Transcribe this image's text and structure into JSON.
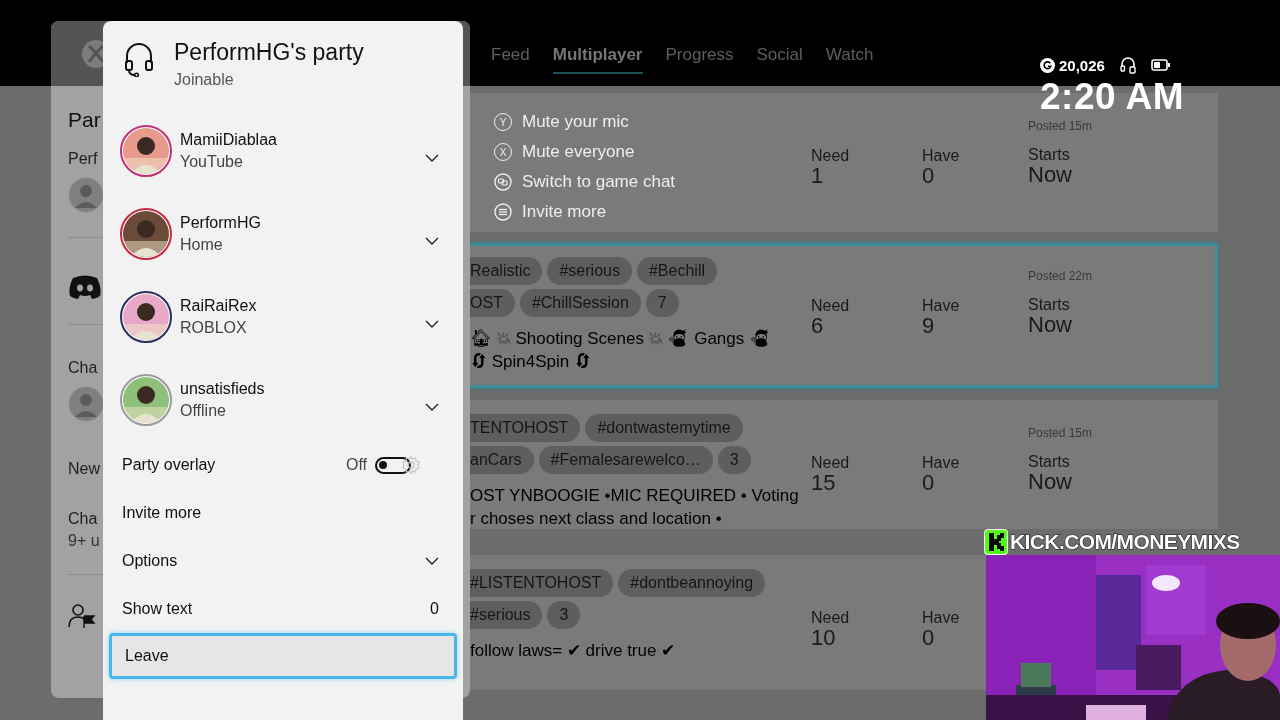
{
  "top_bar": {
    "tabs": [
      {
        "label": "Feed",
        "selected": false
      },
      {
        "label": "Multiplayer",
        "selected": true
      },
      {
        "label": "Progress",
        "selected": false
      },
      {
        "label": "Social",
        "selected": false
      },
      {
        "label": "Watch",
        "selected": false
      }
    ],
    "gamerscore": "20,026",
    "time": "2:20 AM"
  },
  "guide": {
    "items": [
      {
        "kind": "heading",
        "text": "Par"
      },
      {
        "kind": "label",
        "text": "Perf"
      },
      {
        "kind": "avatar"
      },
      {
        "kind": "divider"
      },
      {
        "kind": "discord"
      },
      {
        "kind": "divider"
      },
      {
        "kind": "label",
        "text": "Cha"
      },
      {
        "kind": "avatar"
      },
      {
        "kind": "label",
        "text": "New"
      },
      {
        "kind": "label",
        "text": "Cha"
      },
      {
        "kind": "sub",
        "text": "9+ u"
      },
      {
        "kind": "divider"
      },
      {
        "kind": "person-flag"
      }
    ]
  },
  "posts": [
    {
      "focused": false,
      "hints": [
        {
          "kind": "letter",
          "glyph": "Y",
          "text": "Mute your mic"
        },
        {
          "kind": "letter",
          "glyph": "X",
          "text": "Mute everyone"
        },
        {
          "kind": "view",
          "text": "Switch to game chat"
        },
        {
          "kind": "menu",
          "text": "Invite more"
        }
      ],
      "posted": "Posted 15m",
      "stats": [
        {
          "label": "Need",
          "value": "1"
        },
        {
          "label": "Have",
          "value": "0"
        },
        {
          "label": "Starts",
          "value": "Now"
        }
      ]
    },
    {
      "focused": true,
      "tag_rows": [
        [
          "Realistic",
          "#serious",
          "#Bechill"
        ],
        [
          "OST",
          "#ChillSession",
          "7"
        ]
      ],
      "description": [
        "🏠 💥 Shooting Scenes 💥 🥷 Gangs 🥷",
        "🔄 Spin4Spin 🔄"
      ],
      "posted": "Posted 22m",
      "stats": [
        {
          "label": "Need",
          "value": "6"
        },
        {
          "label": "Have",
          "value": "9"
        },
        {
          "label": "Starts",
          "value": "Now"
        }
      ]
    },
    {
      "focused": false,
      "tag_rows": [
        [
          "TENTOHOST",
          "#dontwastemytime"
        ],
        [
          "anCars",
          "#Femalesarewelco…",
          "3"
        ]
      ],
      "description": [
        "OST YNBOOGIE •MIC REQUIRED • Voting",
        "r choses next class and location •"
      ],
      "posted": "Posted 15m",
      "stats": [
        {
          "label": "Need",
          "value": "15"
        },
        {
          "label": "Have",
          "value": "0"
        },
        {
          "label": "Starts",
          "value": "Now"
        }
      ]
    },
    {
      "focused": false,
      "tag_rows": [
        [
          "#LISTENTOHOST",
          "#dontbeannoying"
        ],
        [
          "#serious",
          "3"
        ]
      ],
      "description": [
        "follow laws= ✔ drive true ✔"
      ],
      "stats": [
        {
          "label": "Need",
          "value": "10"
        },
        {
          "label": "Have",
          "value": "0"
        }
      ]
    }
  ],
  "party": {
    "title": "PerformHG's party",
    "status": "Joinable",
    "members": [
      {
        "name": "MamiiDiablaa",
        "status": "YouTube",
        "color": "#c2307a",
        "expanded": false
      },
      {
        "name": "PerformHG",
        "status": "Home",
        "color": "#c8283c",
        "expanded": false
      },
      {
        "name": "RaiRaiRex",
        "status": "ROBLOX",
        "color": "#2a2f5e",
        "expanded": false
      },
      {
        "name": "unsatisfieds",
        "status": "Offline",
        "color": "#9a9a9a",
        "expanded": false
      }
    ],
    "rows": [
      {
        "kind": "toggle",
        "label": "Party overlay",
        "value": "Off",
        "on": false
      },
      {
        "kind": "action",
        "label": "Invite more",
        "focused": false
      },
      {
        "kind": "dropdown",
        "label": "Options",
        "expanded": false
      },
      {
        "kind": "count",
        "label": "Show text",
        "value": "0"
      },
      {
        "kind": "action",
        "label": "Leave",
        "focused": true
      }
    ]
  },
  "stream_overlay": {
    "label": "KICK.COM/MONEYMIXS"
  }
}
